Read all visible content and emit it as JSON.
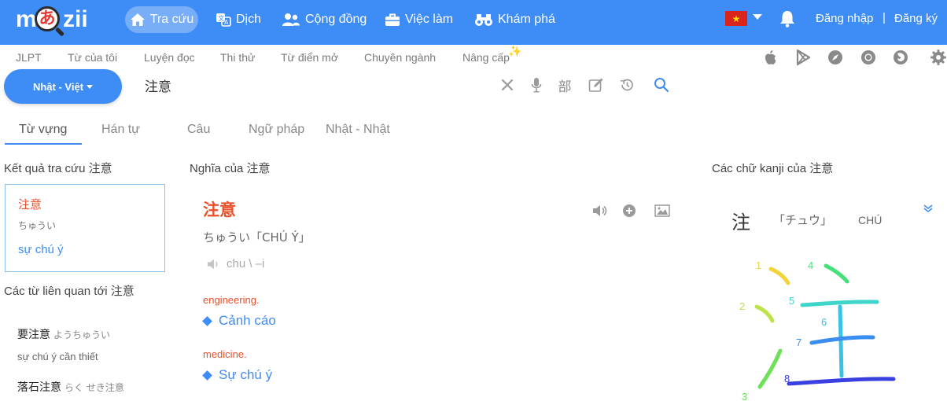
{
  "logo": {
    "m": "m",
    "a": "あ",
    "zii": "zii"
  },
  "nav": {
    "items": [
      {
        "label": "Tra cứu",
        "icon": "home-icon"
      },
      {
        "label": "Dịch",
        "icon": "translate-icon"
      },
      {
        "label": "Cộng đồng",
        "icon": "users-icon"
      },
      {
        "label": "Việc làm",
        "icon": "briefcase-icon"
      },
      {
        "label": "Khám phá",
        "icon": "binoculars-icon"
      }
    ],
    "flag_star": "★",
    "login": "Đăng nhập",
    "separator": "|",
    "register": "Đăng ký"
  },
  "subnav": {
    "items": [
      "JLPT",
      "Từ của tôi",
      "Luyện đọc",
      "Thi thử",
      "Từ điển mở",
      "Chuyên ngành",
      "Nâng cấp"
    ],
    "sparkle": "✨",
    "icons": [
      "apple-icon",
      "google-play-icon",
      "safari-icon",
      "chrome-icon",
      "firefox-icon",
      "settings-icon"
    ]
  },
  "search": {
    "lang": "Nhật - Việt",
    "query": "注意",
    "radical_label": "部",
    "icons": [
      "clear-icon",
      "microphone-icon",
      "radical-icon",
      "handwriting-icon",
      "history-icon",
      "search-icon"
    ]
  },
  "tabs": [
    "Từ vựng",
    "Hán tự",
    "Câu",
    "Ngữ pháp",
    "Nhật - Nhật"
  ],
  "left": {
    "results_title": "Kết quả tra cứu 注意",
    "result": {
      "word": "注意",
      "reading": "ちゅうい",
      "meaning": "sự chú ý"
    },
    "related_title": "Các từ liên quan tới 注意",
    "related": [
      {
        "word": "要注意",
        "reading": "ようちゅうい",
        "meaning": "sự chú ý cần thiết"
      },
      {
        "word": "落石注意",
        "reading": "らく せき注意",
        "meaning": ""
      }
    ]
  },
  "main": {
    "title": "Nghĩa của 注意",
    "word": "注意",
    "reading": "ちゅうい「CHÚ Ý」",
    "romaji": "chu \\ –i",
    "entries": [
      {
        "field": "engineering.",
        "meaning": "Cảnh cáo"
      },
      {
        "field": "medicine.",
        "meaning": "Sự chú ý"
      }
    ]
  },
  "right": {
    "title": "Các chữ kanji của 注意",
    "kanji": "注",
    "katakana": "「チュウ」",
    "hanviet": "CHÚ",
    "stroke_numbers": [
      "1",
      "2",
      "3",
      "4",
      "5",
      "6",
      "7",
      "8"
    ],
    "stroke_colors": [
      "#f0d43a",
      "#bde34a",
      "#6ee05a",
      "#45e07a",
      "#3fd6c9",
      "#38c2e6",
      "#3a8ef0",
      "#3a3fe0"
    ]
  }
}
